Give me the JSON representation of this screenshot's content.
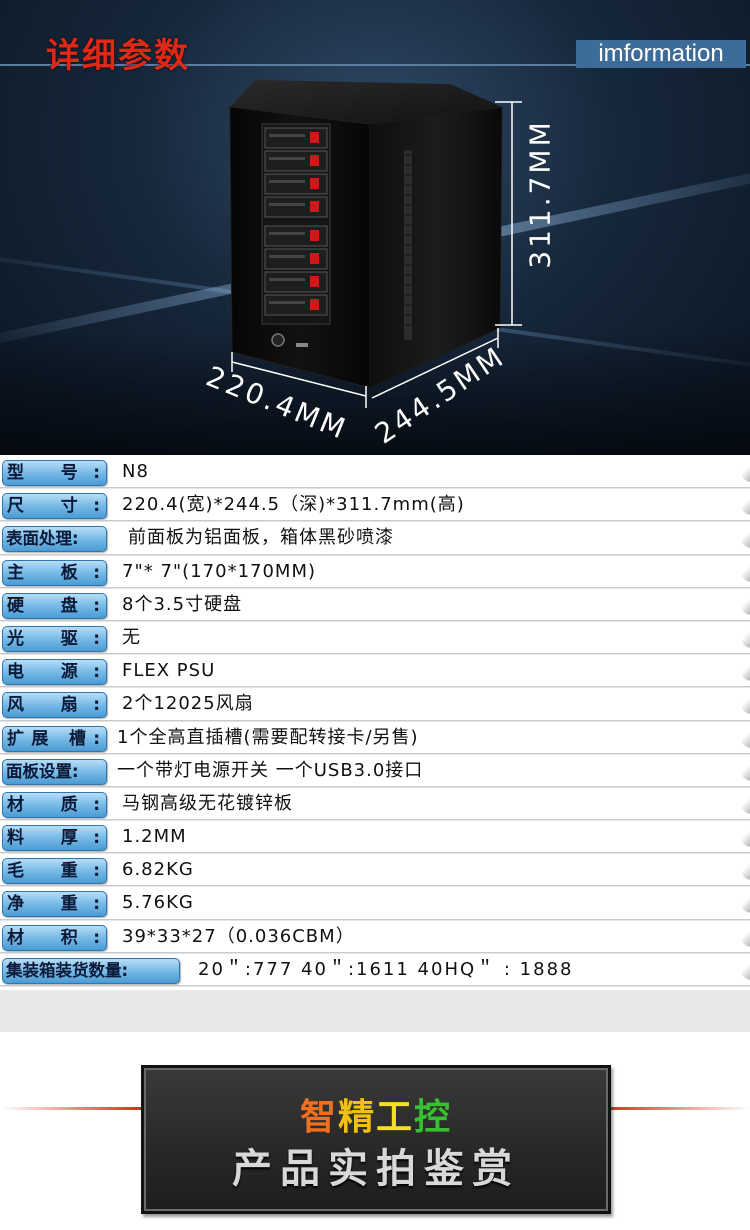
{
  "header": {
    "title": "详细参数",
    "tag": "imformation"
  },
  "dimensions": {
    "height": "311.7MM",
    "width": "220.4MM",
    "depth": "244.5MM"
  },
  "specs": [
    {
      "label": "型 号:",
      "value": "N8"
    },
    {
      "label": "尺 寸:",
      "value": "220.4(宽)*244.5（深)*311.7mm(高)"
    },
    {
      "label": "表面处理:",
      "value": "前面板为铝面板，箱体黑砂喷漆"
    },
    {
      "label": "主 板:",
      "value": "7\"* 7\"(170*170MM)"
    },
    {
      "label": "硬 盘:",
      "value": "8个3.5寸硬盘"
    },
    {
      "label": "光 驱:",
      "value": "无"
    },
    {
      "label": "电 源:",
      "value": "FLEX PSU"
    },
    {
      "label": "风 扇:",
      "value": "2个12025风扇"
    },
    {
      "label": "扩展 槽:",
      "value": "1个全高直插槽(需要配转接卡/另售)"
    },
    {
      "label": "面板设置:",
      "value": "一个带灯电源开关 一个USB3.0接口"
    },
    {
      "label": "材 质:",
      "value": "马钢高级无花镀锌板"
    },
    {
      "label": "料 厚:",
      "value": "1.2MM"
    },
    {
      "label": "毛 重:",
      "value": "6.82KG"
    },
    {
      "label": "净 重:",
      "value": "5.76KG"
    },
    {
      "label": "材 积:",
      "value": "39*33*27（0.036CBM）"
    },
    {
      "label": "集装箱装货数量:",
      "value": "20＂:777 40＂:1611 40HQ＂ : 1888"
    }
  ],
  "banner": {
    "brand": [
      "智",
      "精",
      "工",
      "控"
    ],
    "subtitle": "产品实拍鉴赏"
  }
}
